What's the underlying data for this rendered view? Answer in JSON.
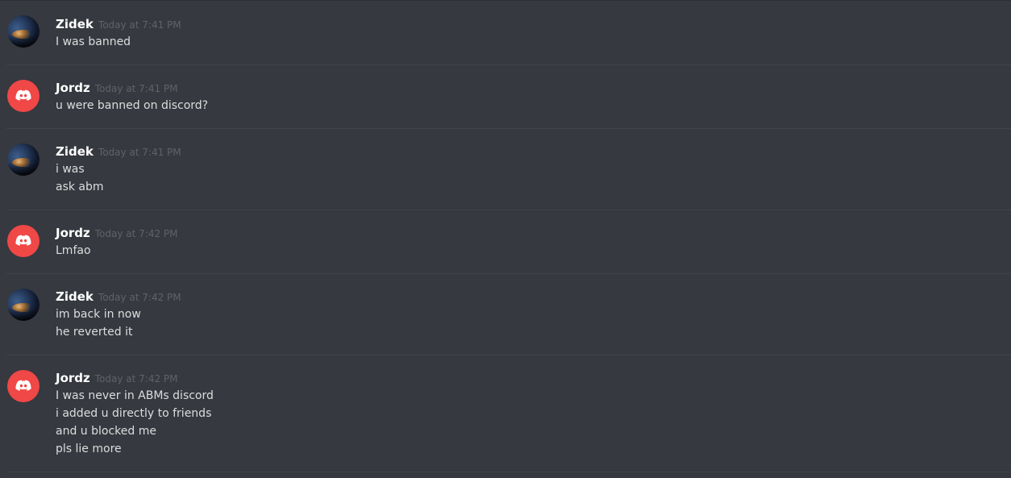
{
  "messages": [
    {
      "username": "Zidek",
      "timestamp": "Today at 7:41 PM",
      "avatar": "landscape-avatar",
      "lines": [
        "I was banned"
      ]
    },
    {
      "username": "Jordz",
      "timestamp": "Today at 7:41 PM",
      "avatar": "discord-logo-avatar",
      "lines": [
        "u were banned on discord?"
      ]
    },
    {
      "username": "Zidek",
      "timestamp": "Today at 7:41 PM",
      "avatar": "landscape-avatar",
      "lines": [
        "i was",
        "ask abm"
      ]
    },
    {
      "username": "Jordz",
      "timestamp": "Today at 7:42 PM",
      "avatar": "discord-logo-avatar",
      "lines": [
        "Lmfao"
      ]
    },
    {
      "username": "Zidek",
      "timestamp": "Today at 7:42 PM",
      "avatar": "landscape-avatar",
      "lines": [
        "im back in now",
        "he reverted it"
      ]
    },
    {
      "username": "Jordz",
      "timestamp": "Today at 7:42 PM",
      "avatar": "discord-logo-avatar",
      "lines": [
        "I was never in ABMs discord",
        "i added u directly to friends",
        "and u blocked me",
        "pls lie more"
      ]
    }
  ],
  "colors": {
    "background": "#36393f",
    "divider": "#40444b",
    "username": "#ffffff",
    "timestamp": "#5f6368",
    "message_text": "#dcddde",
    "discord_avatar": "#f04747"
  }
}
